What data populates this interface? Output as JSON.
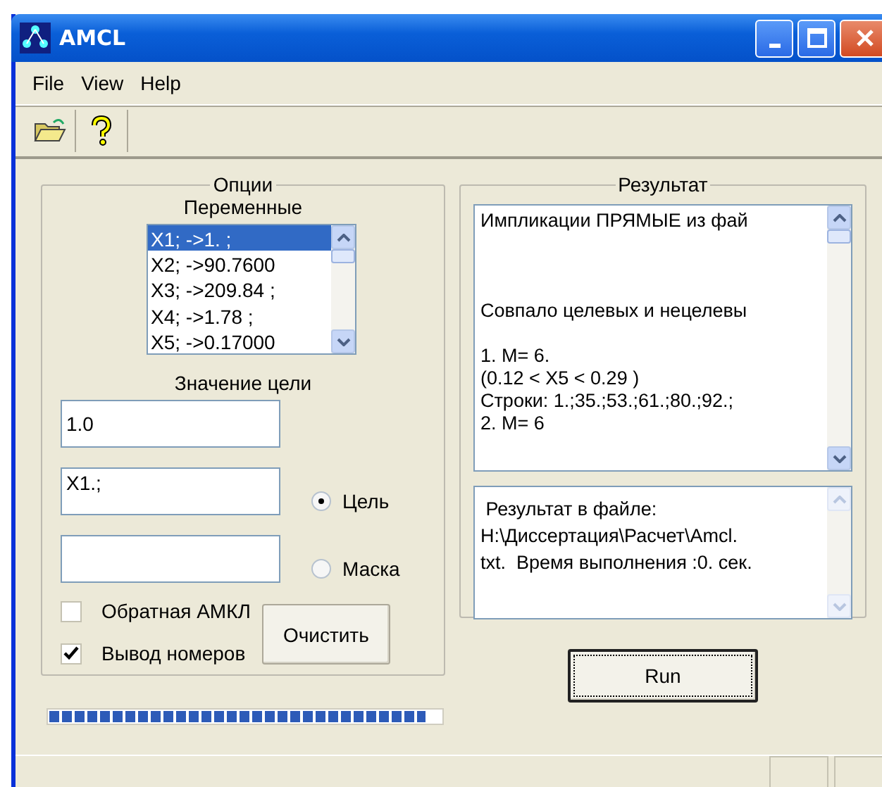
{
  "window": {
    "title": "AMCL"
  },
  "menu": [
    {
      "label": "File"
    },
    {
      "label": "View"
    },
    {
      "label": "Help"
    }
  ],
  "toolbar": [
    {
      "kind": "open"
    },
    {
      "kind": "help"
    }
  ],
  "options": {
    "title": "Опции",
    "variables_label": "Переменные",
    "variables": [
      {
        "text": "X1; ->1. ;",
        "selected": true
      },
      {
        "text": "X2; ->90.7600",
        "selected": false
      },
      {
        "text": "X3; ->209.84 ;",
        "selected": false
      },
      {
        "text": "X4; ->1.78 ;",
        "selected": false
      },
      {
        "text": "X5; ->0.17000",
        "selected": false
      }
    ],
    "goal_label": "Значение цели",
    "goal_value": "1.0",
    "target_value": "X1.;",
    "radios": [
      {
        "label": "Цель",
        "selected": true
      },
      {
        "label": "Маска",
        "selected": false
      }
    ],
    "checkboxes": [
      {
        "label": "Обратная АМКЛ",
        "checked": false
      },
      {
        "label": "Вывод номеров",
        "checked": true
      }
    ],
    "clear_button": "Очистить"
  },
  "progress": {
    "level": 0.96
  },
  "result": {
    "title": "Результат",
    "paragraphs": [
      [
        "Импликации ПРЯМЫЕ из фай"
      ],
      [
        "Совпало целевых и нецелевы"
      ],
      [
        "1.  M= 6.",
        "(0.12 < X5 < 0.29 )",
        "Строки: 1.;35.;53.;61.;80.;92.;",
        "2.  M= 6"
      ]
    ],
    "file_lines": [
      " Результат в файле:",
      "H:\\Диссертация\\Расчет\\Amcl.",
      "txt.  Время выполнения :0. сек."
    ]
  },
  "run_button": "Run"
}
